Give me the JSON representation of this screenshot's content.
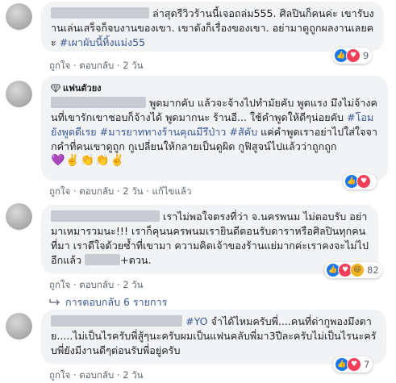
{
  "comments": [
    {
      "text_a": "ล่าสุดรีวิวร้านนี้เจอถล่ม555. ศิลปินก็คนค่ะ เขารับงานเล่นเสร็จก็จบงานของเขา. เขาดังก็เรื่องของเขา. อย่ามาดูถูกผลงานเลยคะ ",
      "hashtag": "#เผาผับนี้ทิ้งแม่ง55",
      "like_label": "ถูกใจ",
      "reply_label": "ตอบกลับ",
      "time": "2 วัน",
      "reaction_count": "9"
    },
    {
      "badge": "แฟนตัวยง",
      "text_a": " พูดมากคับ แล้วจะจ้างไปทำมัยคับ พูดแรง มึงไม่จ้างคนที่เขารักเขาชอบก็จ้างได้ พูดมากนะ ร้านอี... ใช้คำพูดให้ดีๆน่อยคับ ",
      "hashtag1": "#โอมยังพูดดีเรย",
      "hashtag2": "#มารยาททางร้านคุณมีรึป่าว",
      "hashtag3": "#สัคับ",
      "text_b": " แค่คำพูดเราอย่าไปใส่ใจจากคำที่คนเขาดูถูก กูเปลี่ยนให้กลายเป็นดูผิด กูฟิสูจน์ไปแล้วว่าถูกถูก",
      "emojis": "💜✌️👏👏✌️",
      "like_label": "ถูกใจ",
      "reply_label": "ตอบกลับ",
      "time": "2 วัน",
      "edited_label": "แก้ไขแล้ว",
      "reaction_count": ""
    },
    {
      "text_a": "เราไม่พอใจตรงที่ว่า จ.นครพนม ไม่ตอบรับ อย่ามาเหมารวมนะ!!! เราก็คุนนครพนมเรายินดีตอนรับดาราหรือศิลปินทุกคนที่มา เราดีใจด้วยซ้ำที่เขามา ความคิดเจ้าของร้านแย่มากค่ะเราคงจะไม่ไปอีกแล้ว ",
      "text_b": "+ตวน.",
      "like_label": "ถูกใจ",
      "reply_label": "ตอบกลับ",
      "time": "2 วัน",
      "reaction_count": "82",
      "replies_label": "การตอบกลับ 6 รายการ"
    },
    {
      "hashtag": "#YO",
      "text_a": " จำได้ไหมครับพี่....คนที่ด่ากูพองมึงตาย.....ไม่เป็นไรครับพี่สู้ๆนะครับผมเป็นแฟนคลับพี่มา3ปีละครับไม่เป็นไรนะครับพี่ยังมีงานดีๆต่อนรับพี่อยู่ครับ",
      "like_label": "ถูกใจ",
      "reply_label": "ตอบกลับ",
      "time": "2 วัน",
      "reaction_count": "7"
    }
  ],
  "dot": "·",
  "icons": {
    "like": "like-icon",
    "love": "love-icon",
    "haha": "haha-icon",
    "reply_arrow": "reply-arrow-icon",
    "fan_badge": "diamond-icon"
  }
}
